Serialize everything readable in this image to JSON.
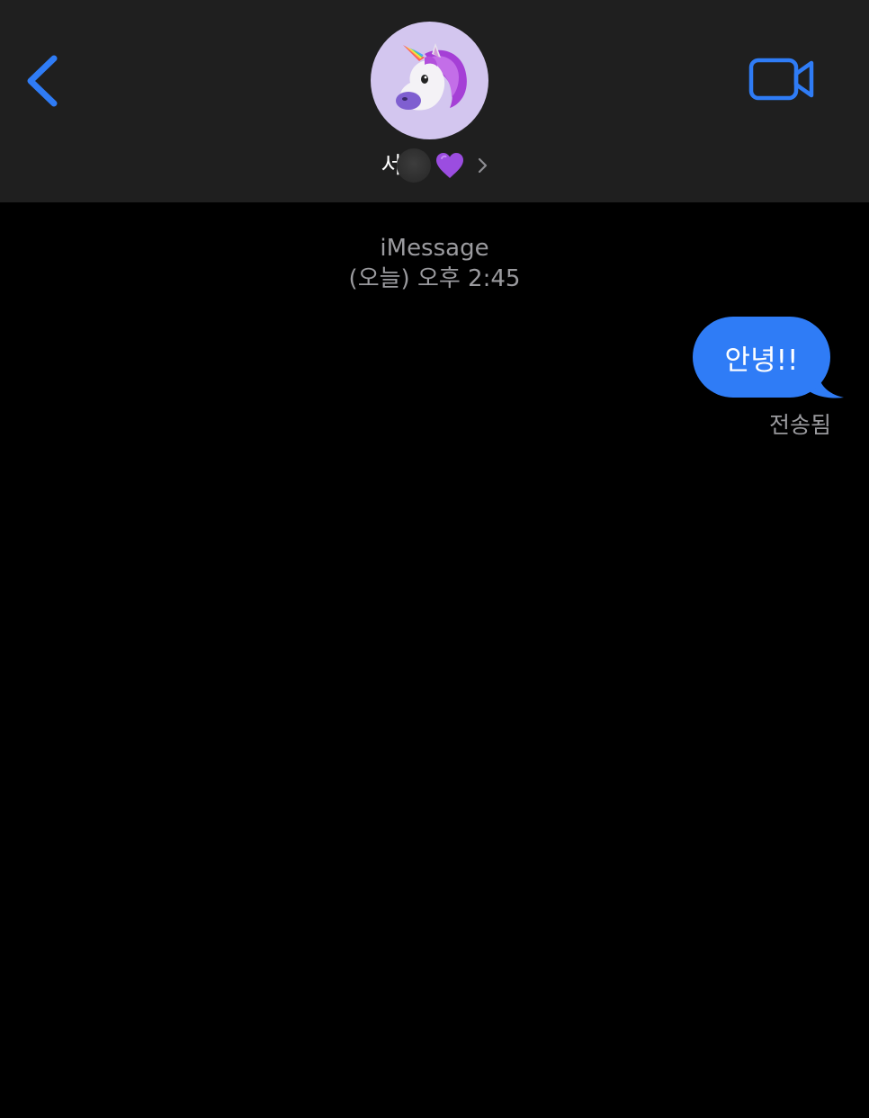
{
  "header": {
    "contact_name": "서",
    "contact_emoji_icon": "purple-heart-icon",
    "avatar_icon": "unicorn-memoji-icon",
    "back_icon": "chevron-left-icon",
    "video_icon": "video-camera-icon",
    "disclosure_icon": "chevron-right-icon"
  },
  "conversation": {
    "service": "iMessage",
    "timestamp": "(오늘) 오후 2:45",
    "messages": [
      {
        "direction": "outgoing",
        "text": "안녕!!",
        "status": "전송됨"
      }
    ]
  },
  "colors": {
    "accent_blue": "#2f7cf6",
    "header_bg": "#1f1f1f",
    "background": "#000000",
    "secondary_text": "#9a9a9e",
    "avatar_bg": "#d3c6ef",
    "heart_purple": "#9b4de0"
  }
}
